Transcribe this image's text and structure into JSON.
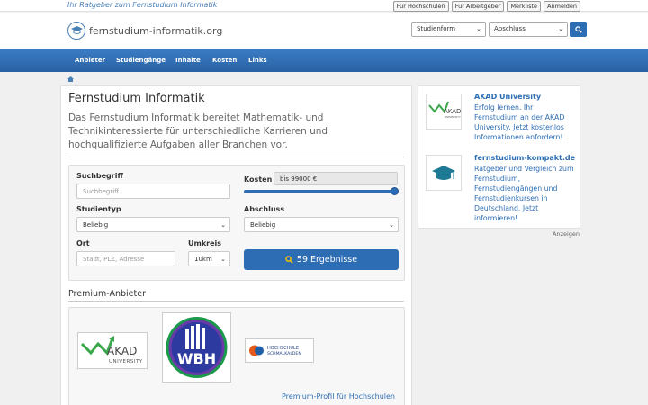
{
  "topbar": {
    "tagline": "Ihr Ratgeber zum Fernstudium Informatik",
    "links": [
      "Für Hochschulen",
      "Für Arbeitgeber",
      "Merkliste",
      "Anmelden"
    ]
  },
  "header": {
    "logo_text": "fernstudium-informatik.org",
    "select_studienform": "Studienform",
    "select_abschluss": "Abschluss"
  },
  "nav": {
    "items": [
      "Anbieter",
      "Studiengänge",
      "Inhalte",
      "Kosten",
      "Links"
    ]
  },
  "main": {
    "title": "Fernstudium Informatik",
    "intro": "Das Fernstudium Informatik bereitet Mathematik- und Technikinteressierte für unterschiedliche Karrieren und hochqualifizierte Aufgaben aller Branchen vor."
  },
  "search": {
    "suchbegriff_label": "Suchbegriff",
    "suchbegriff_placeholder": "Suchbegriff",
    "kosten_label": "Kosten",
    "kosten_value": "bis 99000 €",
    "studientyp_label": "Studientyp",
    "studientyp_value": "Beliebig",
    "abschluss_label": "Abschluss",
    "abschluss_value": "Beliebig",
    "ort_label": "Ort",
    "ort_placeholder": "Stadt, PLZ, Adresse",
    "umkreis_label": "Umkreis",
    "umkreis_value": "10km",
    "results_button": "59 Ergebnisse"
  },
  "premium": {
    "title": "Premium-Anbieter",
    "akad_name": "AKAD",
    "akad_sub": "UNIVERSITY",
    "wbh_name": "WBH",
    "hs_line1": "HOCHSCHULE",
    "hs_line2": "SCHMALKALDEN",
    "profile_link": "Premium-Profil für Hochschulen"
  },
  "ads": {
    "items": [
      {
        "title": "AKAD University",
        "text": "Erfolg lernen. Ihr Fernstudium an der AKAD University. Jetzt kostenlos Informationen anfordern!",
        "logo_name": "AKAD",
        "logo_sub": "UNIVERSITY"
      },
      {
        "title": "fernstudium-kompakt.de",
        "text": "Ratgeber und Vergleich zum Fernstudium, Fernstudiengängen und Fernstudienkursen in Deutschland. Jetzt informieren!"
      }
    ],
    "anzeigen": "Anzeigen"
  },
  "colors": {
    "brand_blue": "#2d6db3",
    "akad_green": "#3aa84a"
  }
}
